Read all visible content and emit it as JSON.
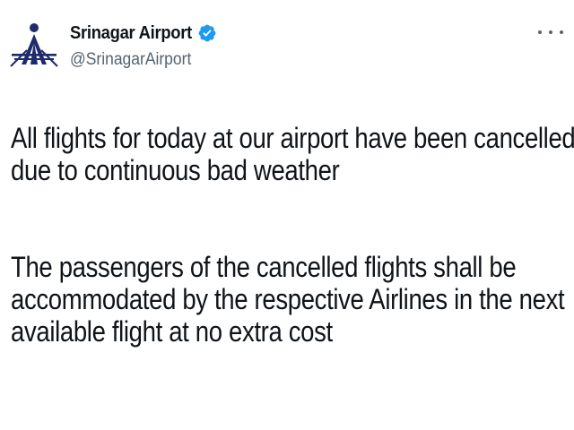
{
  "author": {
    "display_name": "Srinagar Airport",
    "handle": "@SrinagarAirport",
    "verified": true,
    "avatar_icon": "airports-authority-logo-icon",
    "verified_icon": "verified-badge-icon"
  },
  "menu": {
    "icon": "more-options-icon"
  },
  "tweet": {
    "paragraph1_line1": "All flights for today at our airport have been cancelled",
    "paragraph1_line2": "due to continuous bad weather",
    "paragraph2_line1": "The passengers of the cancelled flights shall be",
    "paragraph2_line2": "accommodated by the respective Airlines in the next",
    "paragraph2_line3": "available flight at no extra cost"
  },
  "colors": {
    "text_primary": "#0f1419",
    "text_secondary": "#536471",
    "verified_blue": "#1d9bf0",
    "logo_navy": "#1f2a6b"
  }
}
